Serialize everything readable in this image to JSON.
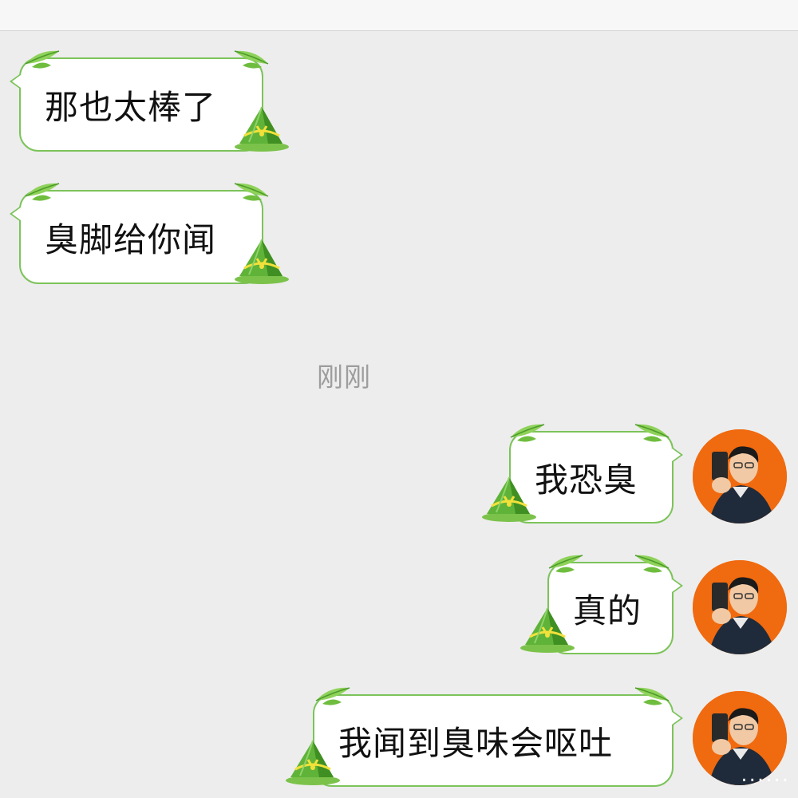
{
  "chat": {
    "timestamp": "刚刚",
    "messages": [
      {
        "side": "left",
        "text": "那也太棒了"
      },
      {
        "side": "left",
        "text": "臭脚给你闻"
      },
      {
        "side": "right",
        "text": "我恐臭"
      },
      {
        "side": "right",
        "text": "真的"
      },
      {
        "side": "right",
        "text": "我闻到臭味会呕吐"
      }
    ]
  },
  "watermark": "......",
  "colors": {
    "background": "#ededed",
    "bubble_border": "#7cc35a",
    "avatar_background": "#f06a10"
  },
  "icons": {
    "bubble_decoration": "zongzi-icon",
    "bubble_leaf": "bamboo-leaf-icon",
    "avatar": "user-avatar"
  }
}
